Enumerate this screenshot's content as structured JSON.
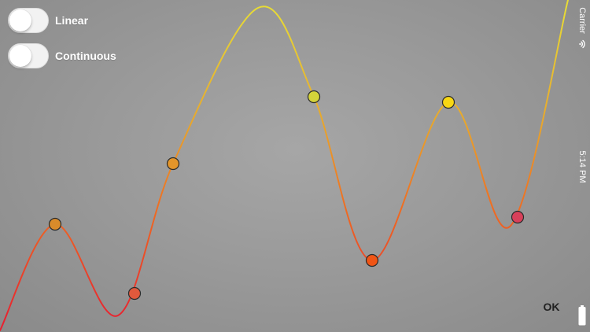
{
  "toggles": [
    {
      "label": "Linear",
      "on": false
    },
    {
      "label": "Continuous",
      "on": false
    }
  ],
  "ok_label": "OK",
  "status_bar": {
    "carrier": "Carrier",
    "time": "5:14 PM",
    "wifi_icon": "wifi-icon",
    "battery_icon": "battery-icon"
  },
  "colors": {
    "curve_red": "#e8202f",
    "curve_orange": "#ee6a22",
    "curve_yellow": "#e8dc34",
    "switch_track": "#f2f2f2"
  },
  "control_points": [
    {
      "label": "",
      "color": "#d98b2a"
    },
    {
      "label": "",
      "color": "#e0593c"
    },
    {
      "label": "",
      "color": "#e3952a"
    },
    {
      "label": "",
      "color": "#d5d43a"
    },
    {
      "label": "",
      "color": "#f05516"
    },
    {
      "label": "",
      "color": "#f8d712"
    },
    {
      "label": "",
      "color": "#d8405a"
    }
  ]
}
